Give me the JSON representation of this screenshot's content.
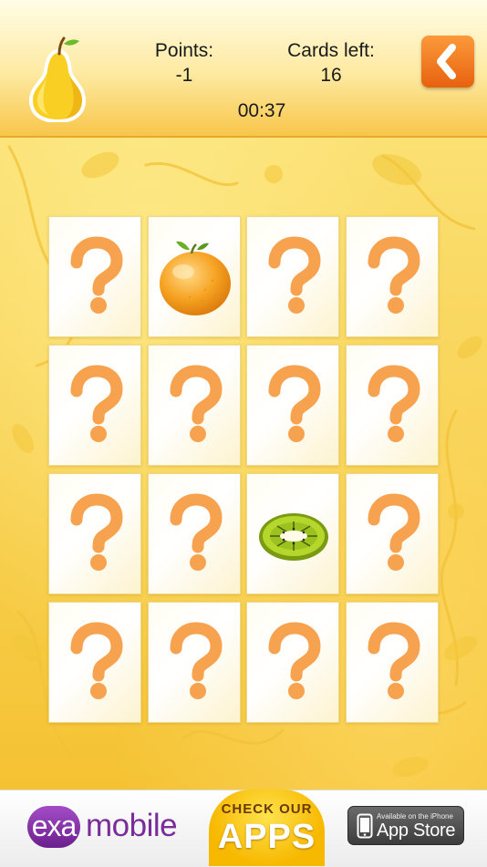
{
  "header": {
    "logo_icon": "pear-icon",
    "points_label": "Points:",
    "points_value": "-1",
    "cards_left_label": "Cards left:",
    "cards_left_value": "16",
    "timer": "00:37",
    "back_icon": "chevron-left-icon"
  },
  "board": {
    "rows": 4,
    "cols": 4,
    "cards": [
      {
        "state": "hidden"
      },
      {
        "state": "revealed",
        "fruit": "orange"
      },
      {
        "state": "hidden"
      },
      {
        "state": "hidden"
      },
      {
        "state": "hidden"
      },
      {
        "state": "hidden"
      },
      {
        "state": "hidden"
      },
      {
        "state": "hidden"
      },
      {
        "state": "hidden"
      },
      {
        "state": "hidden"
      },
      {
        "state": "revealed",
        "fruit": "kiwi"
      },
      {
        "state": "hidden"
      },
      {
        "state": "hidden"
      },
      {
        "state": "hidden"
      },
      {
        "state": "hidden"
      },
      {
        "state": "hidden"
      }
    ],
    "hidden_icon": "question-mark-icon"
  },
  "ad": {
    "brand_pill": "exa",
    "brand_text": "mobile",
    "check_line1": "CHECK OUR",
    "check_line2": "APPS",
    "store_small": "Available on the iPhone",
    "store_big": "App Store"
  },
  "colors": {
    "accent_orange": "#f58a1f",
    "question_mark": "#f7a24f",
    "board_yellow": "#f5c232",
    "brand_purple": "#7a2c9a"
  }
}
